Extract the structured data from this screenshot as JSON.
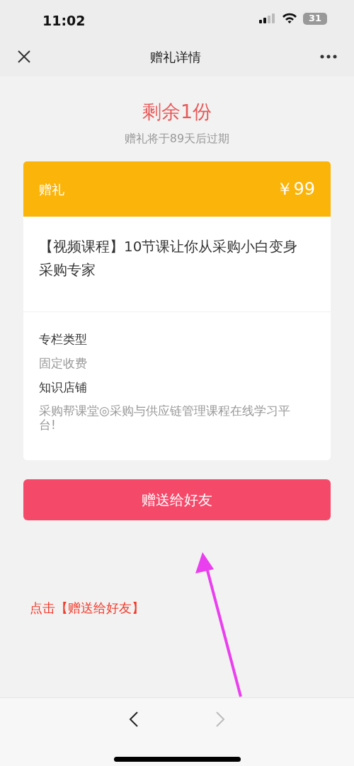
{
  "status_bar": {
    "time": "11:02",
    "battery": "31"
  },
  "nav_bar": {
    "title": "赠礼详情"
  },
  "summary": {
    "remaining": "剩余1份",
    "expiry": "赠礼将于89天后过期"
  },
  "gift_card": {
    "label": "赠礼",
    "price": "￥99",
    "title": "【视频课程】10节课让你从采购小白变身采购专家",
    "details": [
      {
        "label": "专栏类型",
        "value": "固定收费"
      },
      {
        "label": "知识店铺",
        "value": "采购帮课堂◎采购与供应链管理课程在线学习平台!"
      }
    ]
  },
  "send_button": "赠送给好友",
  "annotation": "点击【赠送给好友】",
  "browser_bar": {
    "back_disabled": false,
    "forward_disabled": true
  }
}
